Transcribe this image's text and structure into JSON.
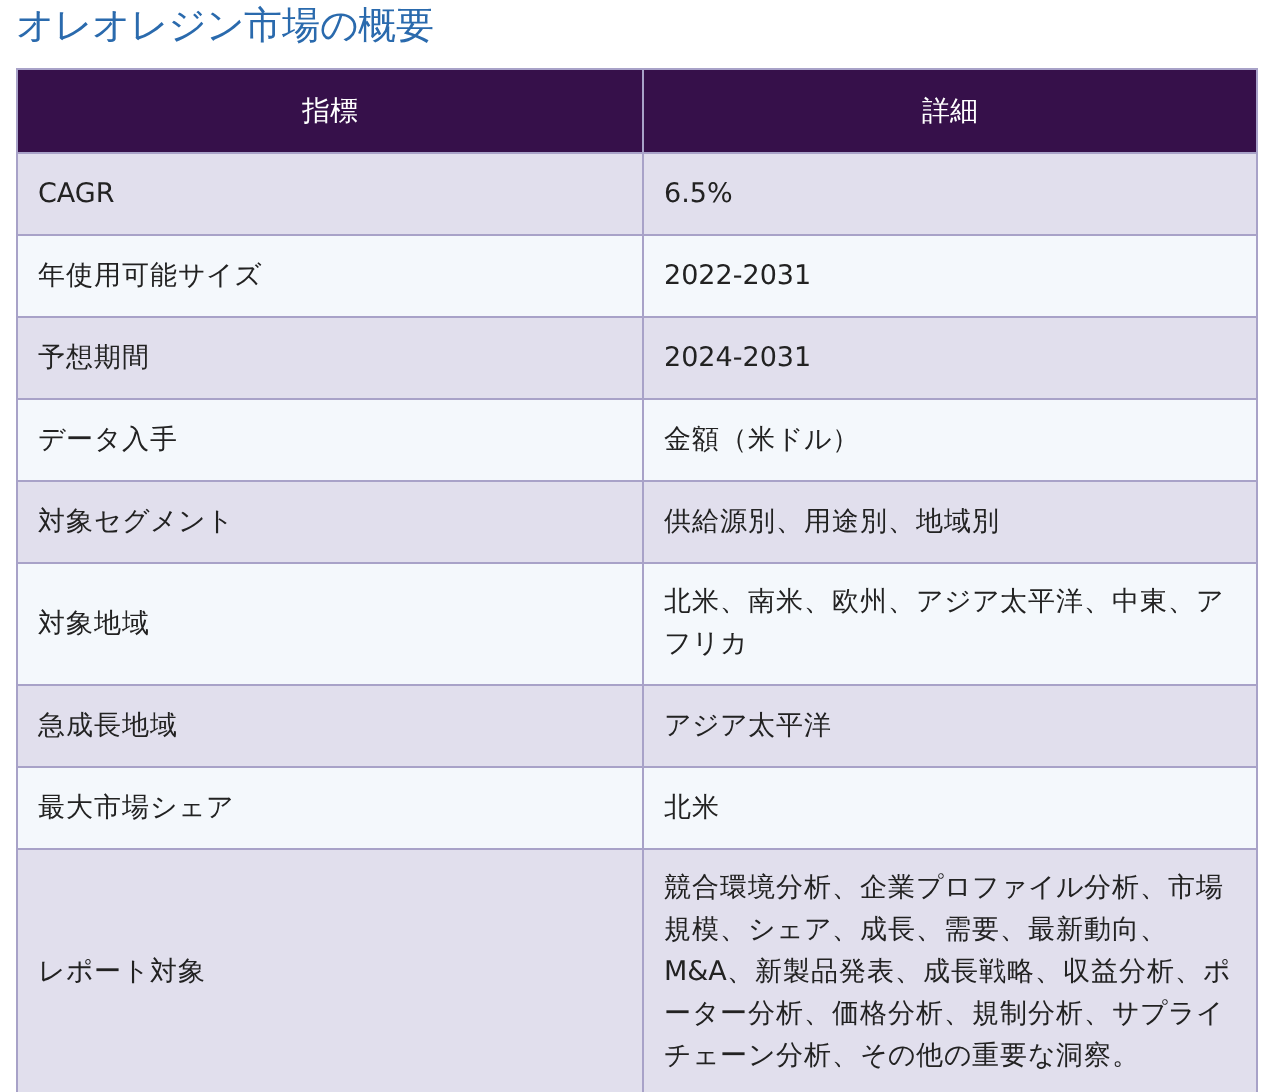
{
  "title": "オレオレジン市場の概要",
  "table": {
    "columns": [
      "指標",
      "詳細"
    ],
    "rows": [
      [
        "CAGR",
        "6.5%"
      ],
      [
        "年使用可能サイズ",
        "2022-2031"
      ],
      [
        "予想期間",
        "2024-2031"
      ],
      [
        "データ入手",
        "金額（米ドル）"
      ],
      [
        "対象セグメント",
        "供給源別、用途別、地域別"
      ],
      [
        "対象地域",
        "北米、南米、欧州、アジア太平洋、中東、アフリカ"
      ],
      [
        "急成長地域",
        "アジア太平洋"
      ],
      [
        "最大市場シェア",
        "北米"
      ],
      [
        "レポート対象",
        "競合環境分析、企業プロファイル分析、市場規模、シェア、成長、需要、最新動向、M&A、新製品発表、成長戦略、収益分析、ポーター分析、価格分析、規制分析、サプライチェーン分析、その他の重要な洞察。"
      ]
    ]
  }
}
